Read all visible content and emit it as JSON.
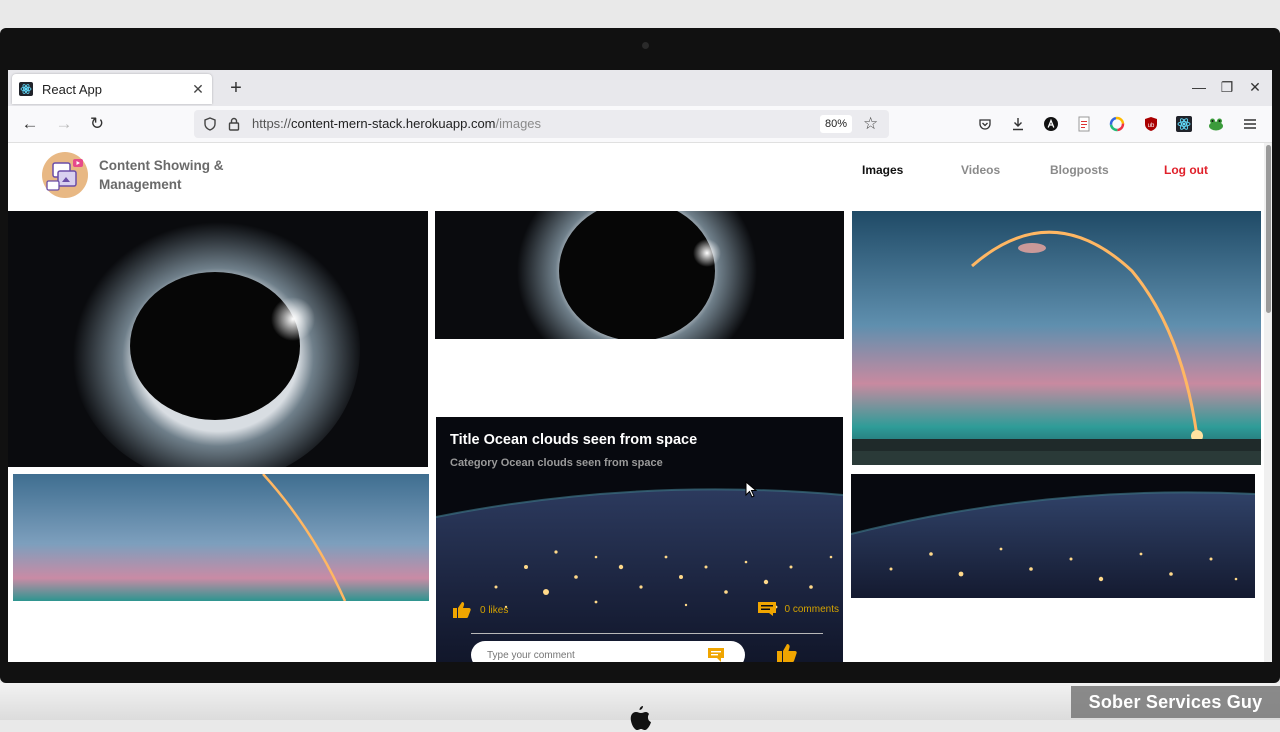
{
  "browser": {
    "tab_title": "React App",
    "tab_close": "✕",
    "new_tab": "+",
    "url_scheme": "https://",
    "url_host": "content-mern-stack.herokuapp.com",
    "url_path": "/images",
    "zoom": "80%"
  },
  "app": {
    "brand_line1": "Content Showing &",
    "brand_line2": "Management",
    "nav": {
      "images": "Images",
      "videos": "Videos",
      "blogposts": "Blogposts",
      "logout": "Log out"
    },
    "active_nav": "Images",
    "logout_color": "#e0202a"
  },
  "featured_card": {
    "title": "Title Ocean clouds seen from space",
    "category": "Category Ocean clouds seen from space",
    "likes": "0 likes",
    "comments": "0 comments",
    "comment_placeholder": "Type your comment",
    "accent_color": "#f0a500"
  },
  "watermark": "Sober Services Guy"
}
